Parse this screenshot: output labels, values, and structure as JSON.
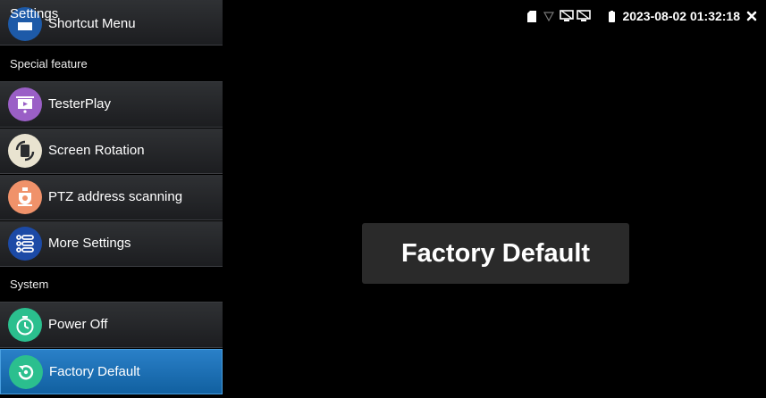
{
  "app": {
    "title": "Settings"
  },
  "status": {
    "datetime": "2023-08-02 01:32:18"
  },
  "sidebar": {
    "top_item": {
      "label": "Shortcut Menu",
      "icon": "shortcut-menu-icon"
    },
    "sections": [
      {
        "title": "Special feature",
        "items": [
          {
            "label": "TesterPlay",
            "icon": "testerplay-icon"
          },
          {
            "label": "Screen Rotation",
            "icon": "screen-rotation-icon"
          },
          {
            "label": "PTZ address scanning",
            "icon": "ptz-camera-icon"
          },
          {
            "label": "More Settings",
            "icon": "list-icon"
          }
        ]
      },
      {
        "title": "System",
        "items": [
          {
            "label": "Power Off",
            "icon": "timer-icon"
          },
          {
            "label": "Factory Default",
            "icon": "restore-icon",
            "selected": true
          }
        ]
      }
    ]
  },
  "dialog": {
    "label": "Factory Default"
  },
  "colors": {
    "selected_item": "#1a6fb5",
    "background": "#000000",
    "dialog": "#2a2a2a"
  }
}
